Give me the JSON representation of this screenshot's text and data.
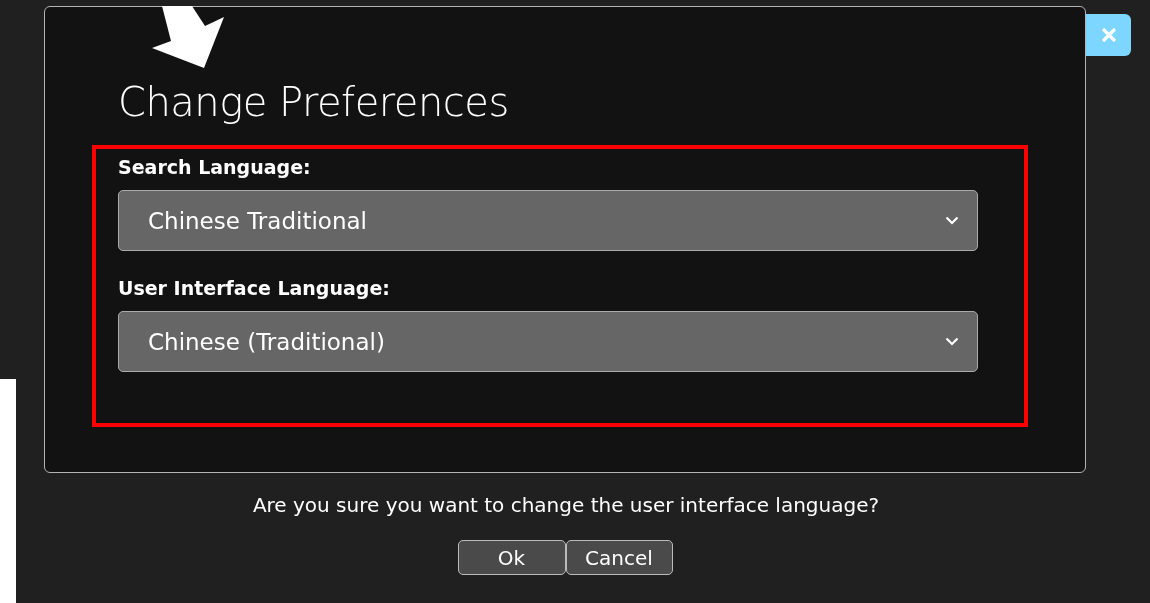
{
  "dialog": {
    "title": "Change Preferences",
    "fields": [
      {
        "label": "Search Language:",
        "value": "Chinese Traditional"
      },
      {
        "label": "User Interface Language:",
        "value": "Chinese (Traditional)"
      }
    ]
  },
  "question": "Are you sure you want to change the user interface language?",
  "buttons": [
    {
      "label": "Ok"
    },
    {
      "label": "Cancel"
    }
  ]
}
